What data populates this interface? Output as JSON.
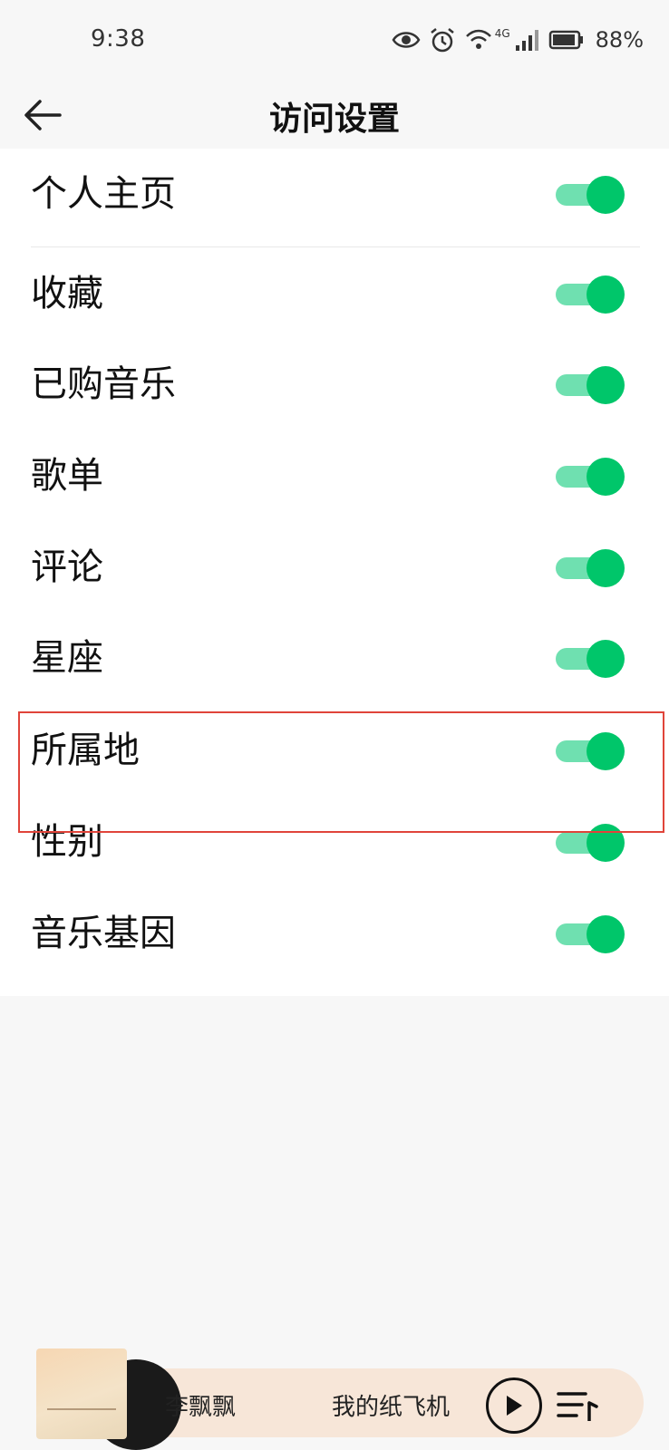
{
  "status_bar": {
    "time": "9:38",
    "network": "4G",
    "battery": "88%",
    "icons": [
      "eye-icon",
      "alarm-icon",
      "wifi-icon",
      "signal-icon",
      "battery-icon"
    ]
  },
  "header": {
    "title": "访问设置",
    "back_icon": "arrow-left-icon"
  },
  "settings": {
    "items": [
      {
        "label": "个人主页",
        "enabled": true
      },
      {
        "label": "收藏",
        "enabled": true
      },
      {
        "label": "已购音乐",
        "enabled": true
      },
      {
        "label": "歌单",
        "enabled": true
      },
      {
        "label": "评论",
        "enabled": true
      },
      {
        "label": "星座",
        "enabled": true
      },
      {
        "label": "所属地",
        "enabled": true
      },
      {
        "label": "性别",
        "enabled": true
      },
      {
        "label": "音乐基因",
        "enabled": true
      }
    ],
    "toggle_on_track_color": "#6fe0b0",
    "toggle_on_thumb_color": "#00c66a",
    "highlight_color": "#e0443a"
  },
  "player": {
    "artist": "李飘飘",
    "song": "我的纸飞机",
    "play_icon": "play-icon",
    "playlist_icon": "playlist-icon"
  }
}
